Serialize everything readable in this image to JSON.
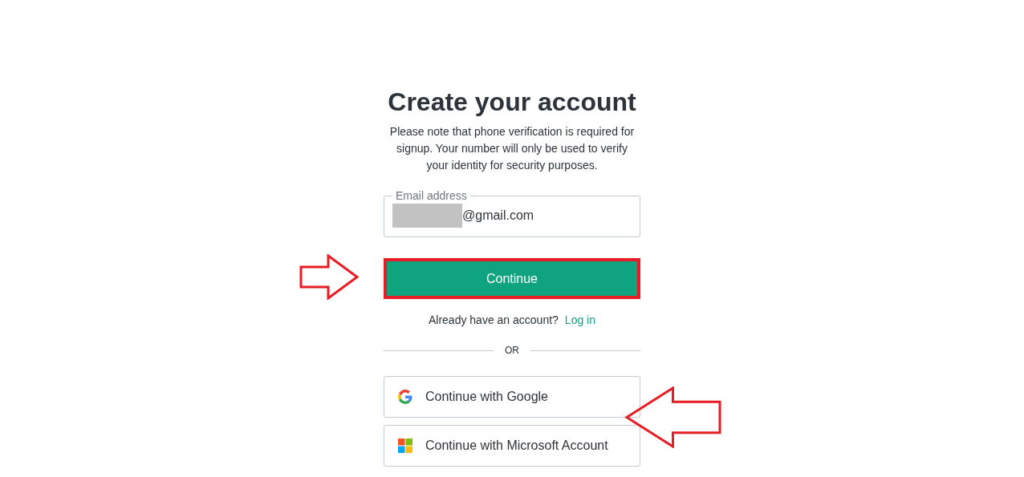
{
  "title": "Create your account",
  "notice": "Please note that phone verification is required for signup. Your number will only be used to verify your identity for security purposes.",
  "email_field": {
    "label": "Email address",
    "value": "@gmail.com",
    "redacted": true
  },
  "continue_button": {
    "label": "Continue",
    "highlighted": true
  },
  "login_prompt": {
    "text": "Already have an account?",
    "link": "Log in"
  },
  "divider": "OR",
  "social_buttons": [
    {
      "kind": "google",
      "label": "Continue with Google"
    },
    {
      "kind": "microsoft",
      "label": "Continue with Microsoft Account"
    }
  ],
  "annotations": [
    {
      "kind": "arrow-right"
    },
    {
      "kind": "arrow-left"
    }
  ]
}
